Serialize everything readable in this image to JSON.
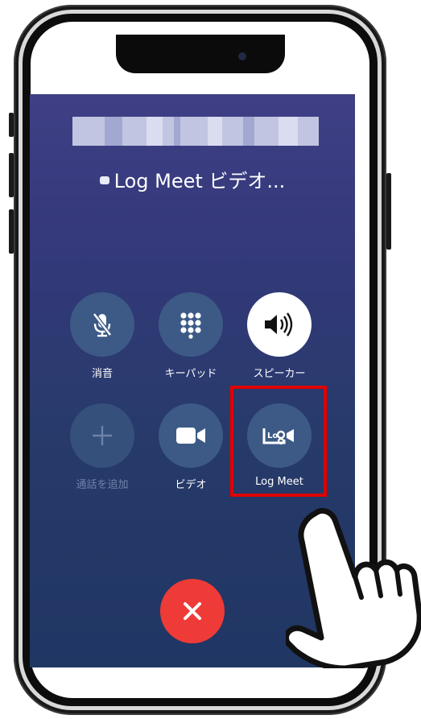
{
  "call": {
    "service_label": "Log Meet ビデオ..."
  },
  "controls": [
    {
      "key": "mute",
      "label": "消音",
      "icon": "microphone-slash-icon"
    },
    {
      "key": "keypad",
      "label": "キーパッド",
      "icon": "keypad-icon"
    },
    {
      "key": "speaker",
      "label": "スピーカー",
      "icon": "speaker-icon"
    },
    {
      "key": "add_call",
      "label": "通話を追加",
      "icon": "plus-icon"
    },
    {
      "key": "video",
      "label": "ビデオ",
      "icon": "video-camera-icon"
    },
    {
      "key": "log_meet",
      "label": "Log Meet",
      "icon": "log-meet-logo-icon"
    }
  ],
  "end_call": {
    "icon": "close-icon",
    "color": "#ef3b37"
  },
  "colors": {
    "highlight": "#e00000",
    "button_bg": "#3d5a86"
  }
}
